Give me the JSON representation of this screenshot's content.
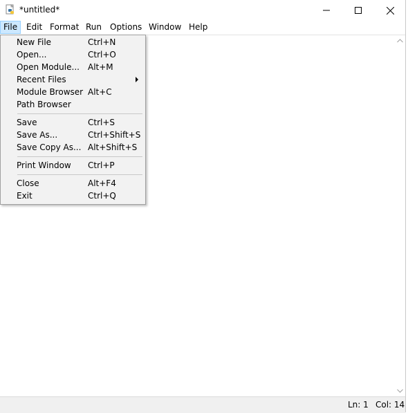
{
  "window": {
    "title": "*untitled*",
    "icon": "python-idle-icon",
    "controls": [
      "minimize-icon",
      "maximize-icon",
      "close-icon"
    ]
  },
  "menubar": {
    "file": "File",
    "edit": "Edit",
    "format": "Format",
    "run": "Run",
    "options": "Options",
    "window": "Window",
    "help": "Help"
  },
  "file_menu": {
    "items": [
      {
        "label": "New File",
        "shortcut": "Ctrl+N"
      },
      {
        "label": "Open...",
        "shortcut": "Ctrl+O"
      },
      {
        "label": "Open Module...",
        "shortcut": "Alt+M"
      },
      {
        "label": "Recent Files",
        "shortcut": ""
      },
      {
        "label": "Module Browser",
        "shortcut": "Alt+C"
      },
      {
        "label": "Path Browser",
        "shortcut": ""
      },
      {
        "label": "Save",
        "shortcut": "Ctrl+S"
      },
      {
        "label": "Save As...",
        "shortcut": "Ctrl+Shift+S"
      },
      {
        "label": "Save Copy As...",
        "shortcut": "Alt+Shift+S"
      },
      {
        "label": "Print Window",
        "shortcut": "Ctrl+P"
      },
      {
        "label": "Close",
        "shortcut": "Alt+F4"
      },
      {
        "label": "Exit",
        "shortcut": "Ctrl+Q"
      }
    ]
  },
  "statusbar": {
    "ln": "Ln: 1",
    "col": "Col: 14"
  },
  "colors": {
    "menu_active_bg": "#cce8ff",
    "menu_active_border": "#99d1ff",
    "dropdown_bg": "#f2f2f2",
    "statusbar_bg": "#f0f0f0"
  }
}
